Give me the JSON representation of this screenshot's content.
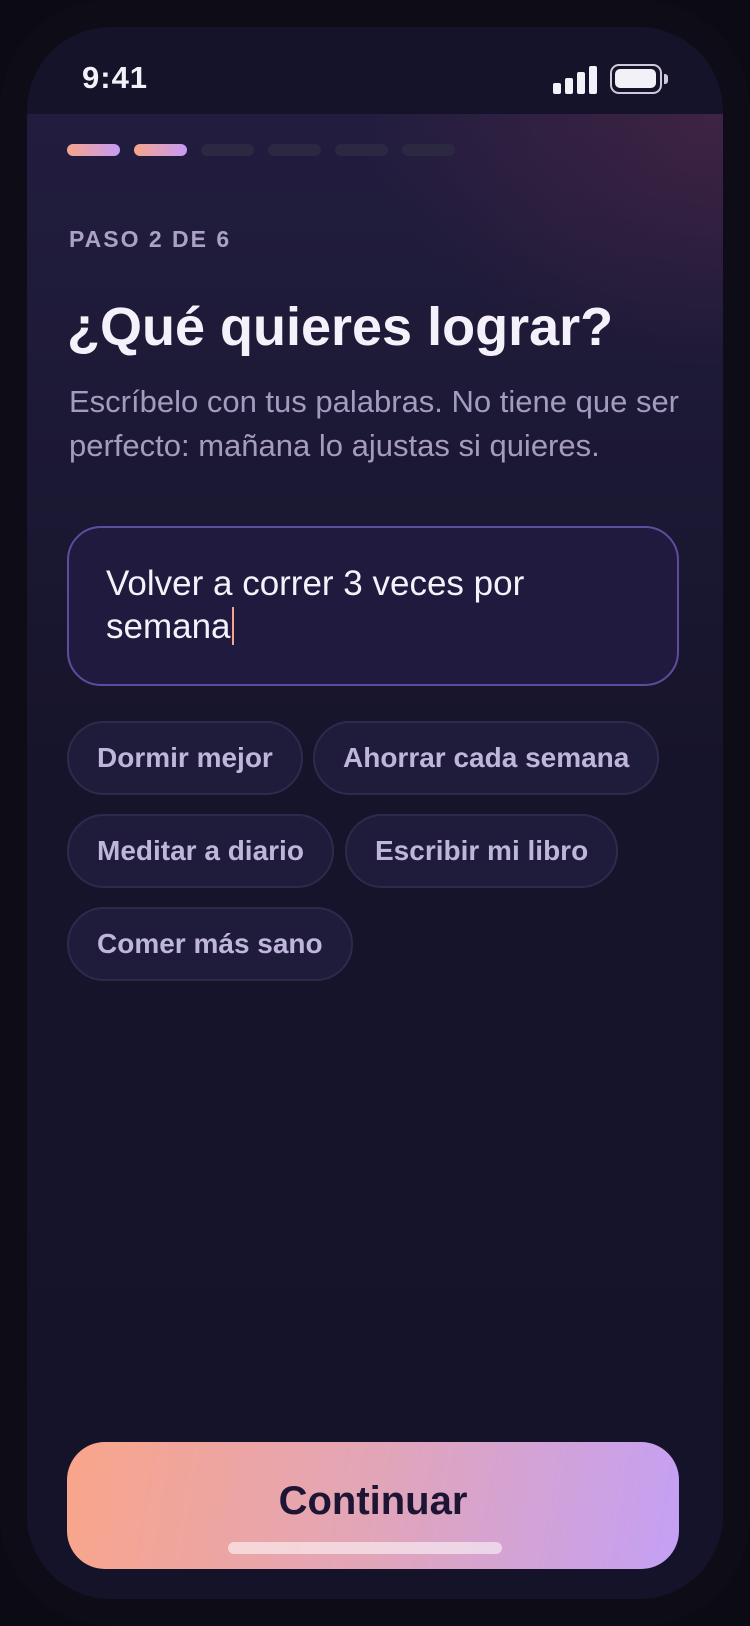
{
  "status_bar": {
    "time": "9:41"
  },
  "progress": {
    "current_step": 2,
    "total_steps": 6,
    "step_label": "PASO 2 DE 6"
  },
  "question": {
    "title": "¿Qué quieres lograr?",
    "subtitle": "Escríbelo con tus palabras. No tiene que ser perfecto: mañana lo ajustas si quieres."
  },
  "goal_input": {
    "value": "Volver a correr 3 veces por semana"
  },
  "suggestions": [
    "Dormir mejor",
    "Ahorrar cada semana",
    "Meditar a diario",
    "Escribir mi libro",
    "Comer más sano"
  ],
  "actions": {
    "continue_label": "Continuar"
  },
  "colors": {
    "accent_start": "#f6a48c",
    "accent_end": "#c59cf5",
    "background": "#16142a"
  }
}
